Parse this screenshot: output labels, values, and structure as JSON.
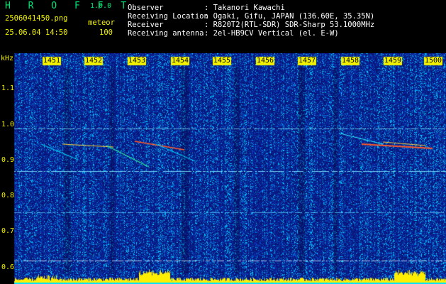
{
  "app": {
    "name": "H R O F F T",
    "version": "1.0.0"
  },
  "capture": {
    "filename": "2506041450.png",
    "datetime": "25.06.04 14:50",
    "mode_label": "meteor",
    "gain_value": "100"
  },
  "info": {
    "observer_label": "Observer",
    "observer_value": ": Takanori Kawachi",
    "location_label": "Receiving Location",
    "location_value": ": Ogaki, Gifu, JAPAN (136.60E, 35.35N)",
    "receiver_label": "Receiver",
    "receiver_value": ": R820T2(RTL-SDR) SDR-Sharp 53.1000MHz",
    "antenna_label": "Receiving antenna",
    "antenna_value": ": 2el-HB9CV Vertical (el. E-W)"
  },
  "axes": {
    "y_unit": "kHz",
    "y_ticks": [
      "1.1",
      "1.0",
      "0.9",
      "0.8",
      "0.7",
      "0.6"
    ],
    "x_ticks": [
      "1451",
      "1452",
      "1453",
      "1454",
      "1455",
      "1456",
      "1457",
      "1458",
      "1459",
      "1500"
    ]
  },
  "colors": {
    "background": "#000000",
    "spectrogram_base": "#0a1c8c",
    "noise_hi": "#00b4ff",
    "echo": "#ff3c1e",
    "activity_bar": "#ffee00",
    "header_yellow": "#f2f200",
    "header_green": "#00e676"
  }
}
